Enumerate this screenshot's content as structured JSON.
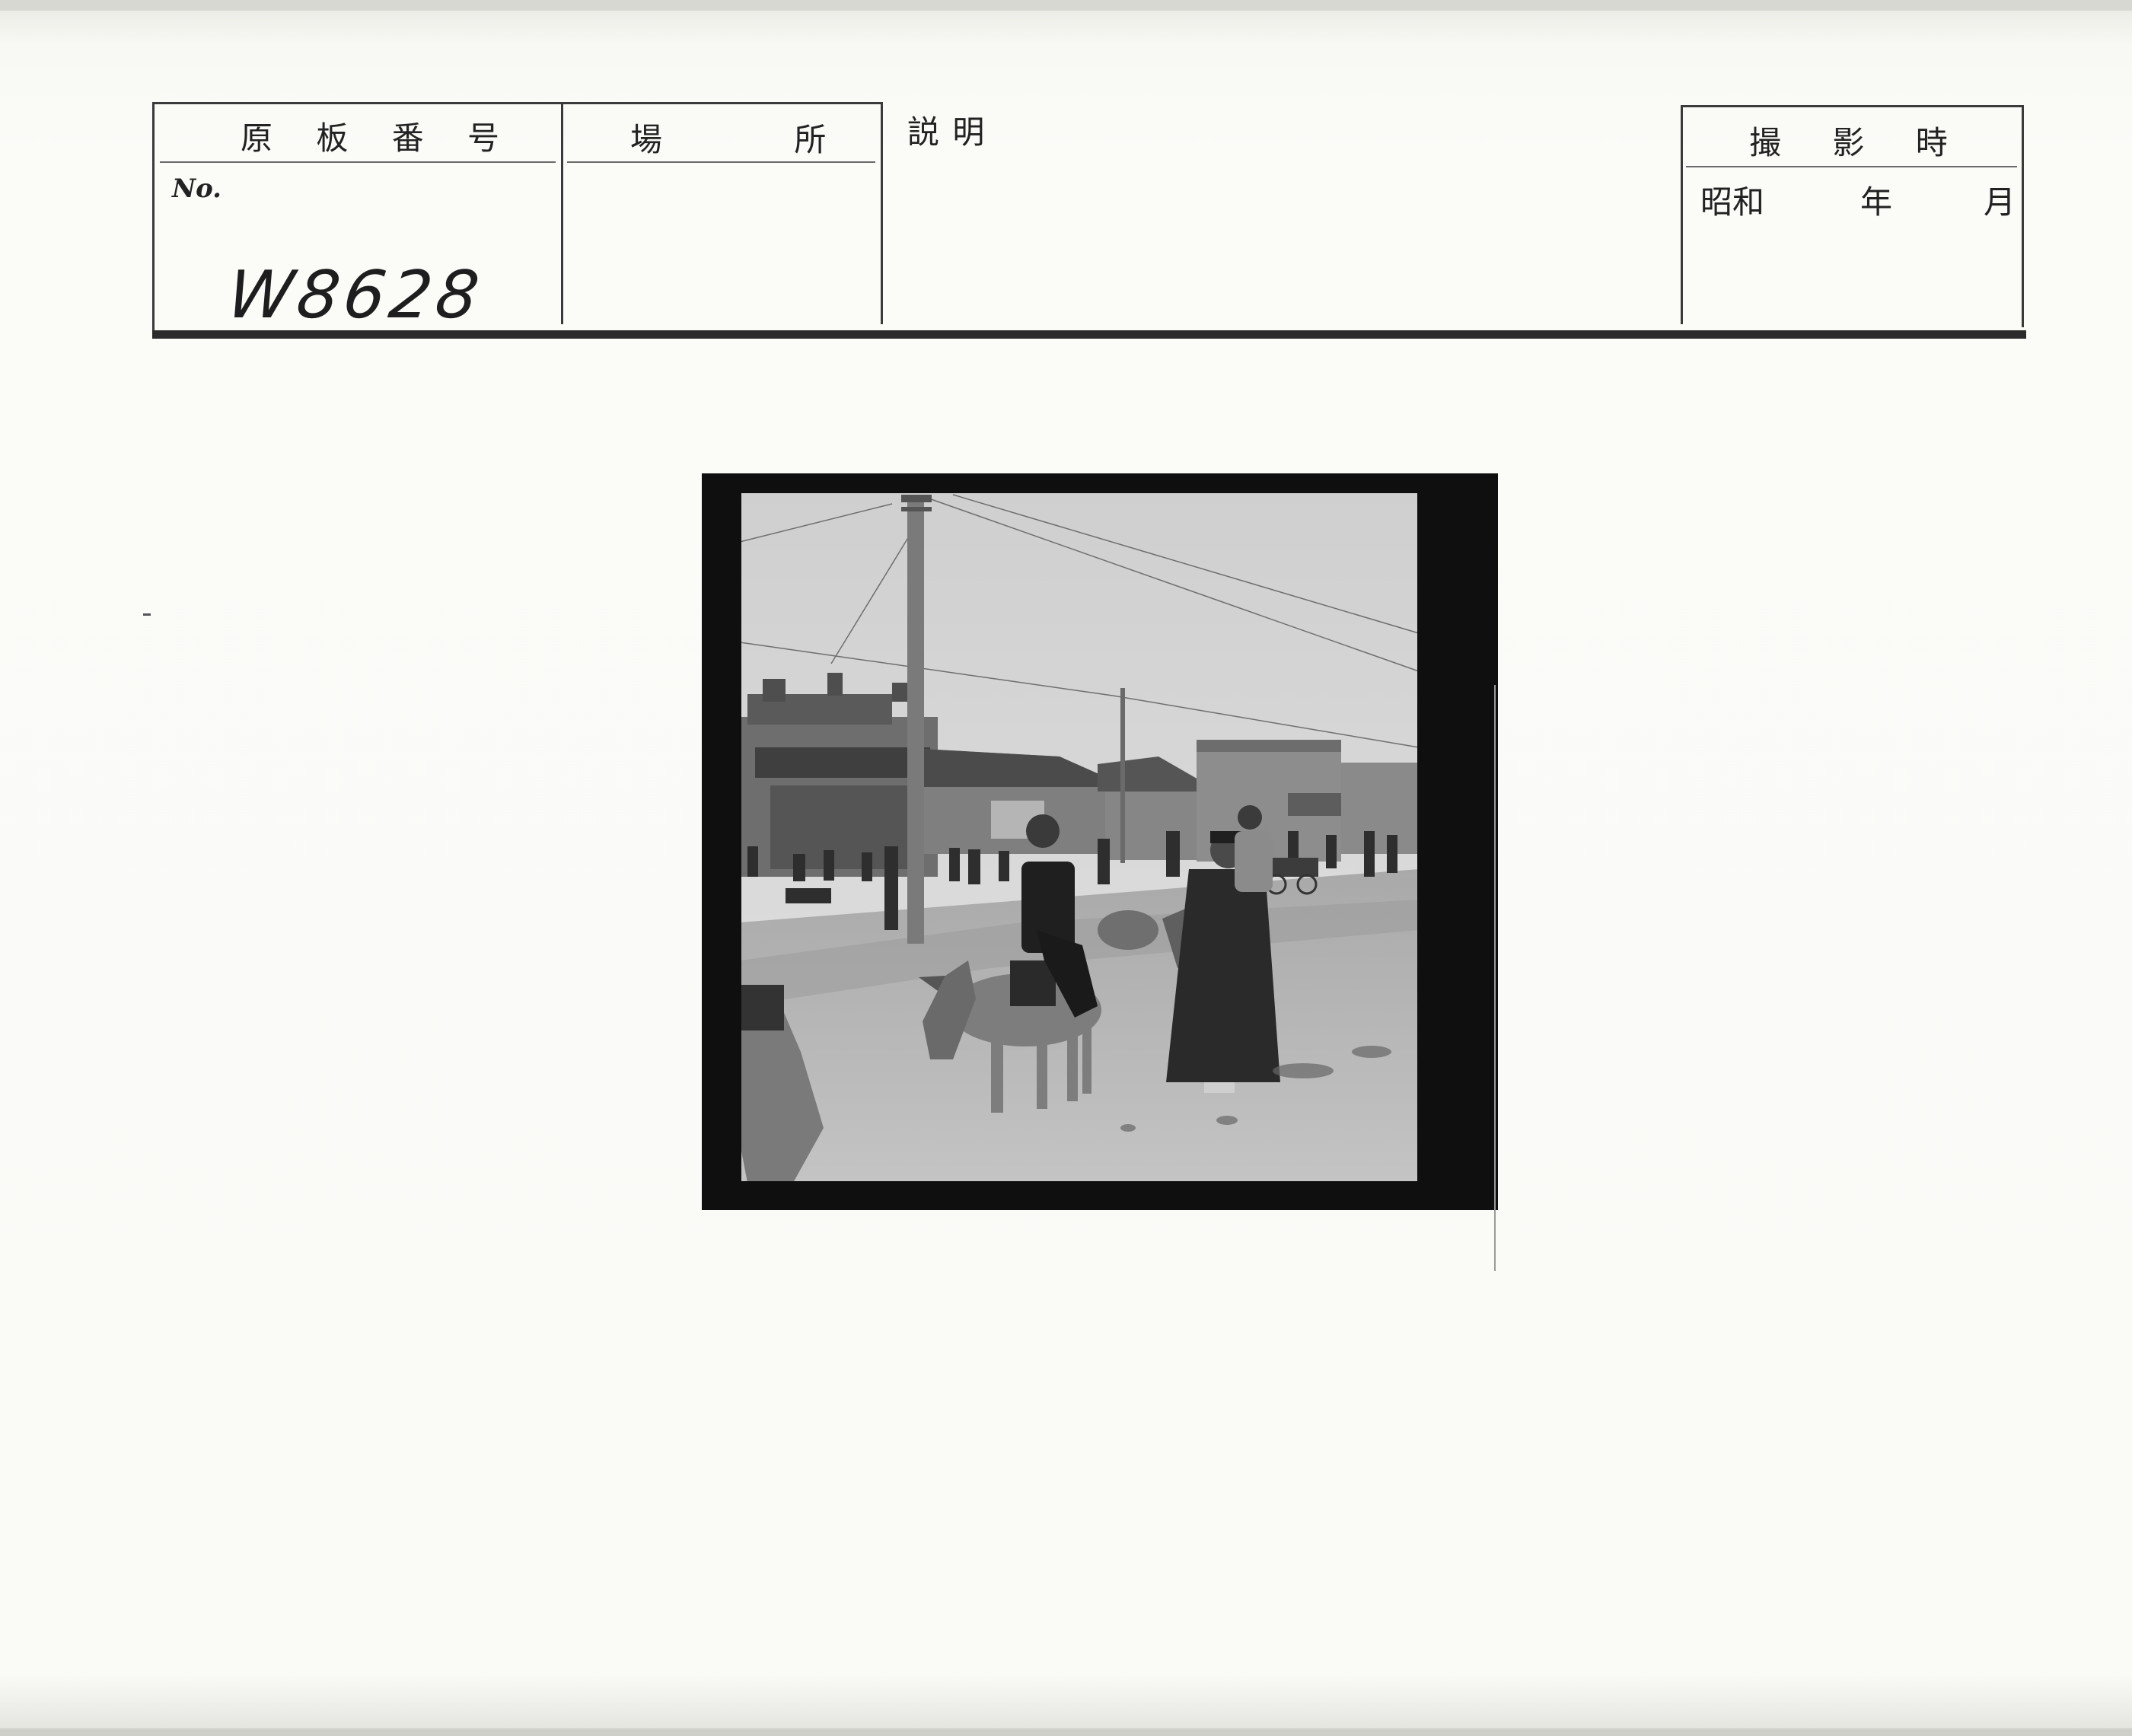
{
  "header": {
    "plate_number_label": "原 板 番 号",
    "location_label": "場 所",
    "description_label": "説 明",
    "photo_date_label": "撮 影 時",
    "no_label": "No.",
    "plate_number_handwritten": "W8628",
    "era_label": "昭和",
    "year_label": "年",
    "month_label": "月"
  },
  "photo": {
    "tone": "black-and-white street scene"
  }
}
